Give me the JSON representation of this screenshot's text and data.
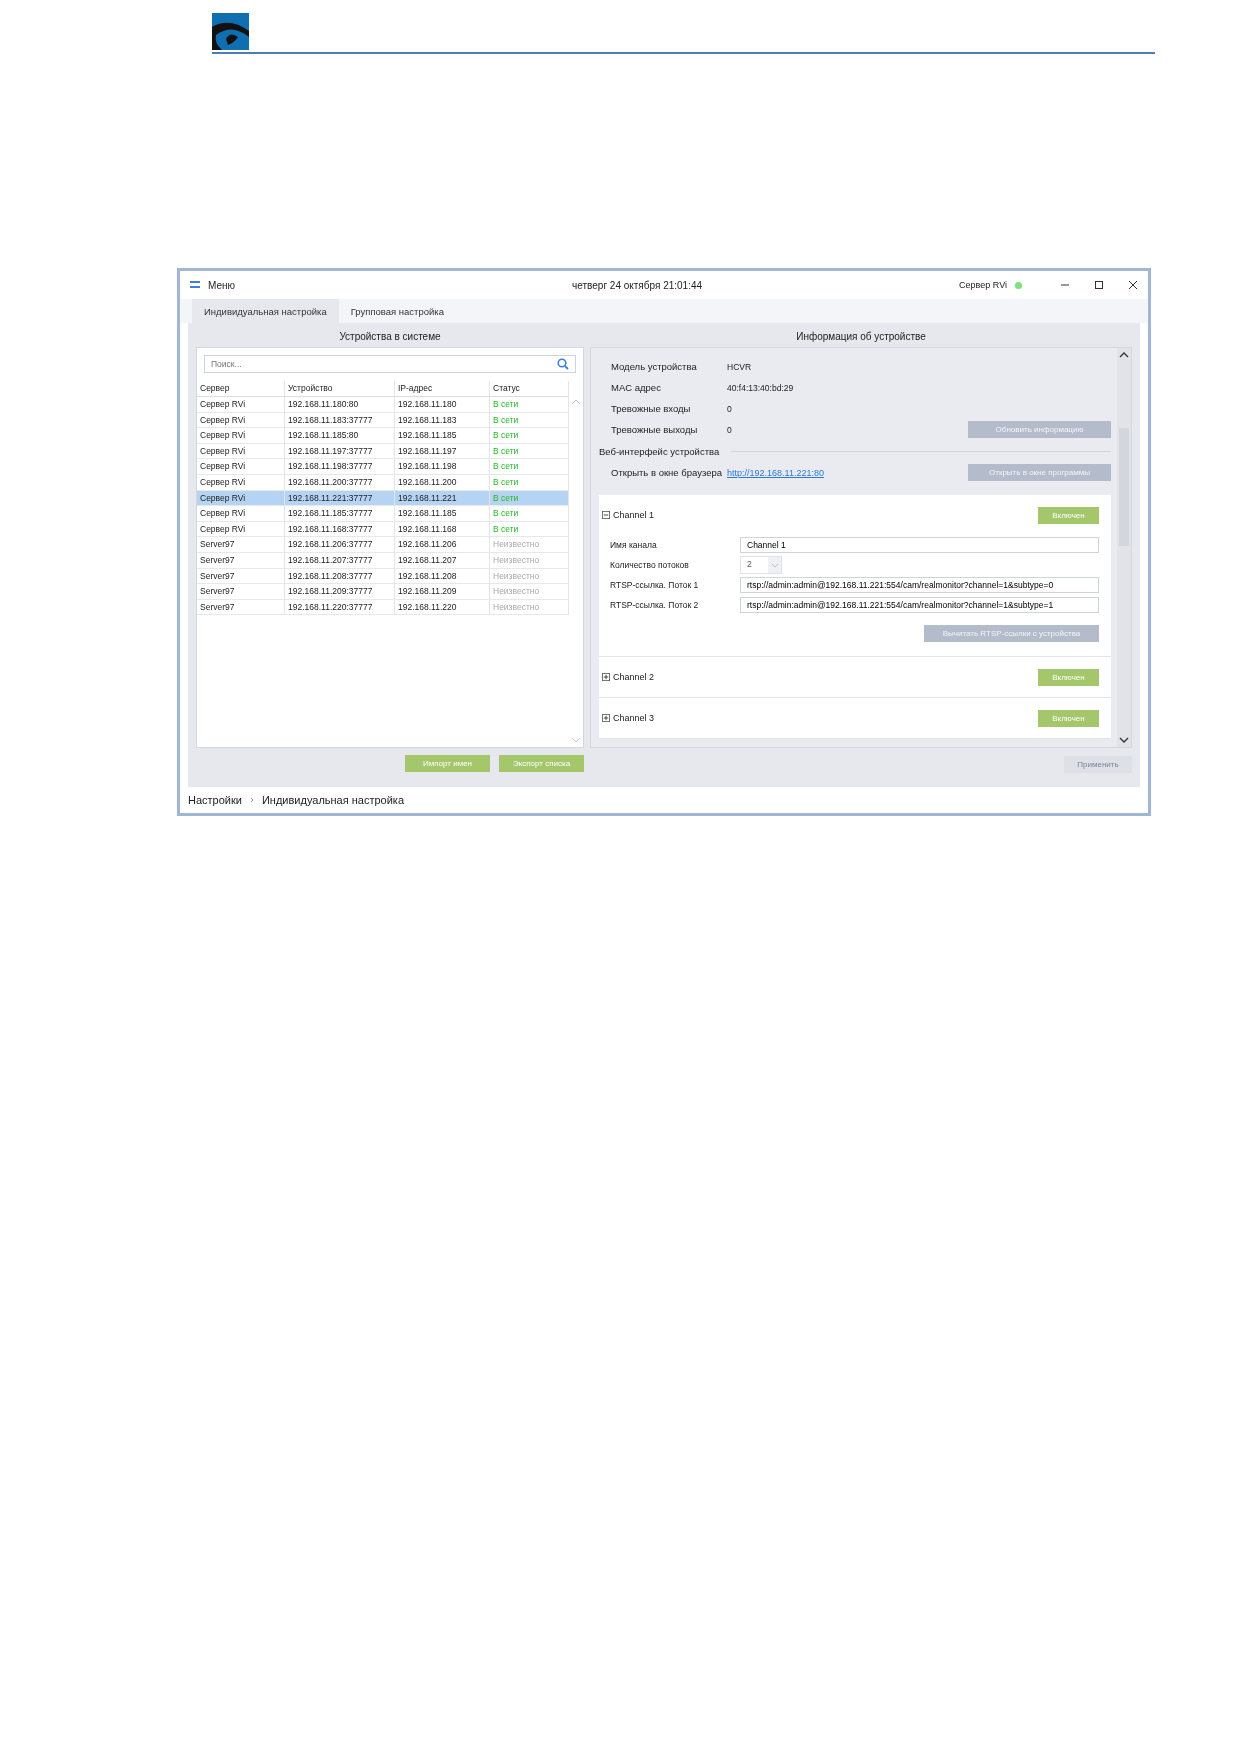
{
  "window": {
    "menu_label": "Меню",
    "datetime": "четверг 24 октября 21:01:44",
    "server_label": "Сервер RVi",
    "server_online": true
  },
  "tabs": [
    {
      "label": "Индивидуальная настройка",
      "selected": true
    },
    {
      "label": "Групповая настройка",
      "selected": false
    }
  ],
  "devices_panel": {
    "title": "Устройства в системе",
    "search": {
      "placeholder": "Поиск..."
    },
    "table": {
      "columns": [
        "Сервер",
        "Устройство",
        "IP-адрес",
        "Статус"
      ],
      "rows": [
        {
          "server": "Сервер RVi",
          "device": "192.168.11.180:80",
          "ip": "192.168.11.180",
          "status": "В сети",
          "online": true,
          "selected": false
        },
        {
          "server": "Сервер RVi",
          "device": "192.168.11.183:37777",
          "ip": "192.168.11.183",
          "status": "В сети",
          "online": true,
          "selected": false
        },
        {
          "server": "Сервер RVi",
          "device": "192.168.11.185:80",
          "ip": "192.168.11.185",
          "status": "В сети",
          "online": true,
          "selected": false
        },
        {
          "server": "Сервер RVi",
          "device": "192.168.11.197:37777",
          "ip": "192.168.11.197",
          "status": "В сети",
          "online": true,
          "selected": false
        },
        {
          "server": "Сервер RVi",
          "device": "192.168.11.198:37777",
          "ip": "192.168.11.198",
          "status": "В сети",
          "online": true,
          "selected": false
        },
        {
          "server": "Сервер RVi",
          "device": "192.168.11.200:37777",
          "ip": "192.168.11.200",
          "status": "В сети",
          "online": true,
          "selected": false
        },
        {
          "server": "Сервер RVi",
          "device": "192.168.11.221:37777",
          "ip": "192.168.11.221",
          "status": "В сети",
          "online": true,
          "selected": true
        },
        {
          "server": "Сервер RVi",
          "device": "192.168.11.185:37777",
          "ip": "192.168.11.185",
          "status": "В сети",
          "online": true,
          "selected": false
        },
        {
          "server": "Сервер RVi",
          "device": "192.168.11.168:37777",
          "ip": "192.168.11.168",
          "status": "В сети",
          "online": true,
          "selected": false
        },
        {
          "server": "Server97",
          "device": "192.168.11.206:37777",
          "ip": "192.168.11.206",
          "status": "Неизвестно",
          "online": false,
          "selected": false
        },
        {
          "server": "Server97",
          "device": "192.168.11.207:37777",
          "ip": "192.168.11.207",
          "status": "Неизвестно",
          "online": false,
          "selected": false
        },
        {
          "server": "Server97",
          "device": "192.168.11.208:37777",
          "ip": "192.168.11.208",
          "status": "Неизвестно",
          "online": false,
          "selected": false
        },
        {
          "server": "Server97",
          "device": "192.168.11.209:37777",
          "ip": "192.168.11.209",
          "status": "Неизвестно",
          "online": false,
          "selected": false
        },
        {
          "server": "Server97",
          "device": "192.168.11.220:37777",
          "ip": "192.168.11.220",
          "status": "Неизвестно",
          "online": false,
          "selected": false
        }
      ]
    },
    "buttons": [
      "Импорт имен",
      "Экспорт списка"
    ]
  },
  "info_panel": {
    "title": "Информация об устройстве",
    "fields": [
      {
        "label": "Модель устройства",
        "value": "HCVR"
      },
      {
        "label": "MAC адрес",
        "value": "40:f4:13:40:bd:29"
      },
      {
        "label": "Тревожные входы",
        "value": "0"
      },
      {
        "label": "Тревожные выходы",
        "value": "0"
      }
    ],
    "refresh_button": "Обновить информацию",
    "web_section": "Веб-интерфейс устройства",
    "browser_label": "Открыть в окне браузера",
    "browser_link": "http://192.168.11.221:80",
    "program_button": "Открыть в окне программы",
    "channels": [
      {
        "title": "Channel 1",
        "expanded": true,
        "state_button": "Включен",
        "fields": [
          {
            "kind": "text",
            "label": "Имя канала",
            "value": "Channel 1"
          },
          {
            "kind": "select",
            "label": "Количество потоков",
            "value": "2"
          },
          {
            "kind": "text",
            "label": "RTSP-ссылка. Поток 1",
            "value": "rtsp://admin:admin@192.168.11.221:554/cam/realmonitor?channel=1&subtype=0"
          },
          {
            "kind": "text",
            "label": "RTSP-ссылка. Поток 2",
            "value": "rtsp://admin:admin@192.168.11.221:554/cam/realmonitor?channel=1&subtype=1"
          }
        ],
        "read_button": "Вычитать RTSP-ссылки с устройства"
      },
      {
        "title": "Channel 2",
        "expanded": false,
        "state_button": "Включен"
      },
      {
        "title": "Channel 3",
        "expanded": false,
        "state_button": "Включен"
      }
    ]
  },
  "apply_button": {
    "label": "Применить",
    "disabled": true
  },
  "breadcrumb": [
    "Настройки",
    "Индивидуальная настройка"
  ]
}
